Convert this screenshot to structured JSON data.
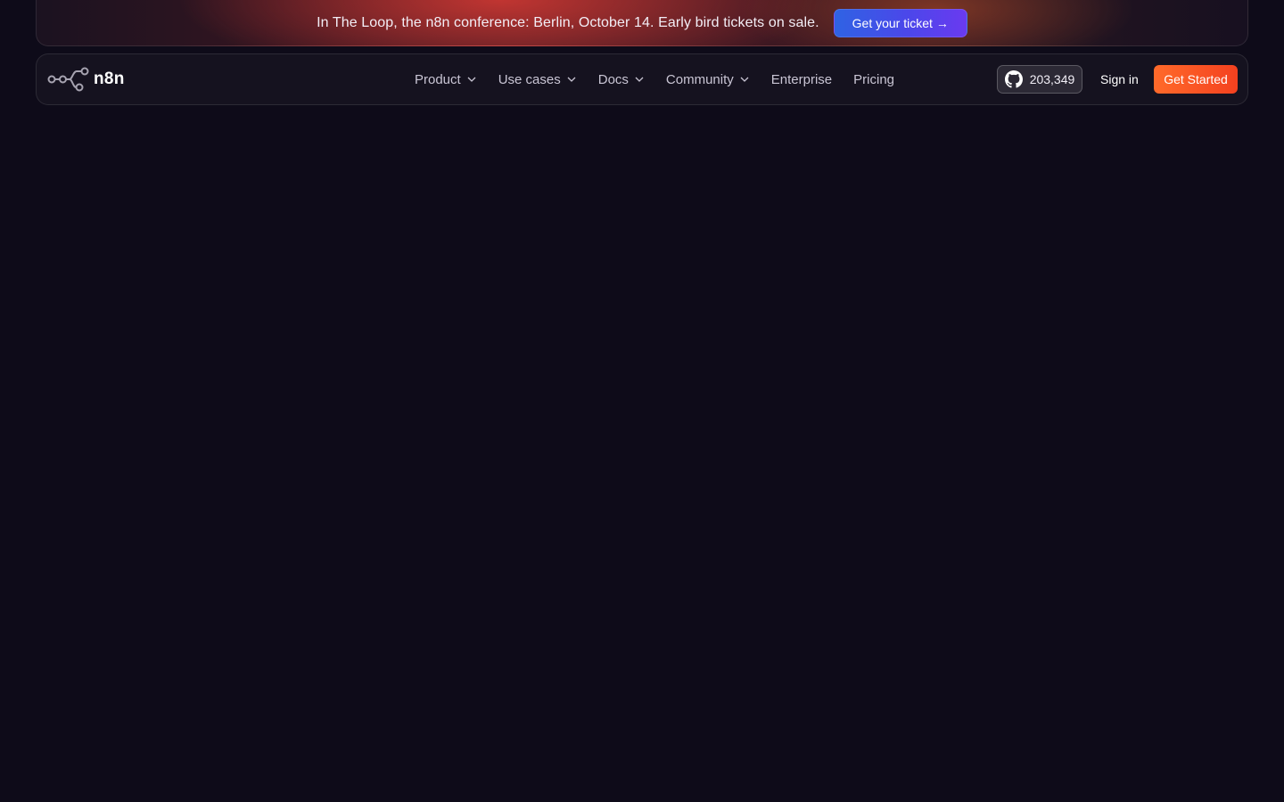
{
  "banner": {
    "text": "In The Loop, the n8n conference: Berlin, October 14. Early bird tickets on sale.",
    "cta_label": "Get your ticket",
    "cta_icon": "arrow-right-icon",
    "cta_arrow": "→"
  },
  "header": {
    "logo_text": "n8n",
    "logo_icon": "n8n-nodes-logo-icon",
    "nav": [
      {
        "label": "Product",
        "icon": "chevron-down-icon"
      },
      {
        "label": "Use cases",
        "icon": "chevron-down-icon"
      },
      {
        "label": "Docs",
        "icon": "chevron-down-icon"
      },
      {
        "label": "Community",
        "icon": "chevron-down-icon"
      },
      {
        "label": "Enterprise"
      },
      {
        "label": "Pricing"
      }
    ],
    "github": {
      "icon": "github-icon",
      "stars": "203,349"
    },
    "sign_in_label": "Sign in",
    "get_started_label": "Get Started"
  },
  "colors": {
    "page_background": "#0e0b19",
    "cta_primary": "#ff6a2a",
    "ticket_button": "#4b47ea"
  }
}
